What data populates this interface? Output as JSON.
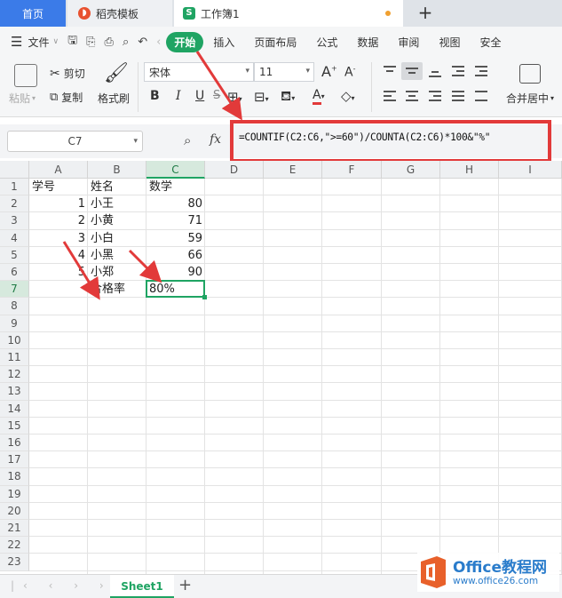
{
  "tabs": {
    "home": "首页",
    "docer": "稻壳模板",
    "workbook": "工作簿1",
    "s_icon": "S"
  },
  "menu": {
    "file": "文件",
    "start": "开始",
    "insert": "插入",
    "page_layout": "页面布局",
    "formula": "公式",
    "data": "数据",
    "review": "审阅",
    "view": "视图",
    "security": "安全"
  },
  "ribbon": {
    "paste": "粘贴",
    "cut": "剪切",
    "copy": "复制",
    "format_painter": "格式刷",
    "font_name": "宋体",
    "font_size": "11",
    "bold": "B",
    "italic": "I",
    "underline": "U",
    "grow_font": "A",
    "shrink_font": "A",
    "font_color": "A",
    "merge_center": "合并居中"
  },
  "formula_bar": {
    "name_box": "C7",
    "fx": "fx",
    "formula": "=COUNTIF(C2:C6,\">=60\")/COUNTA(C2:C6)*100&\"%\""
  },
  "grid": {
    "columns": [
      "A",
      "B",
      "C",
      "D",
      "E",
      "F",
      "G",
      "H",
      "I"
    ],
    "rows": [
      "1",
      "2",
      "3",
      "4",
      "5",
      "6",
      "7",
      "8",
      "9",
      "10",
      "11",
      "12",
      "13",
      "14",
      "15",
      "16",
      "17",
      "18",
      "19",
      "20",
      "21",
      "22",
      "23"
    ],
    "cells": {
      "A1": "学号",
      "B1": "姓名",
      "C1": "数学",
      "A2": "1",
      "B2": "小王",
      "C2": "80",
      "A3": "2",
      "B3": "小黄",
      "C3": "71",
      "A4": "3",
      "B4": "小白",
      "C4": "59",
      "A5": "4",
      "B5": "小黑",
      "C5": "66",
      "A6": "5",
      "B6": "小郑",
      "C6": "90",
      "B7": "合格率",
      "C7": "80%"
    },
    "selected_cell": "C7"
  },
  "sheets": {
    "active": "Sheet1",
    "add": "+"
  },
  "watermark": {
    "title": "Office教程网",
    "url": "www.office26.com"
  },
  "colors": {
    "accent": "#1fa463",
    "home_tab": "#3b7be8",
    "highlight": "#e23a3a",
    "watermark": "#2a7ccb"
  }
}
